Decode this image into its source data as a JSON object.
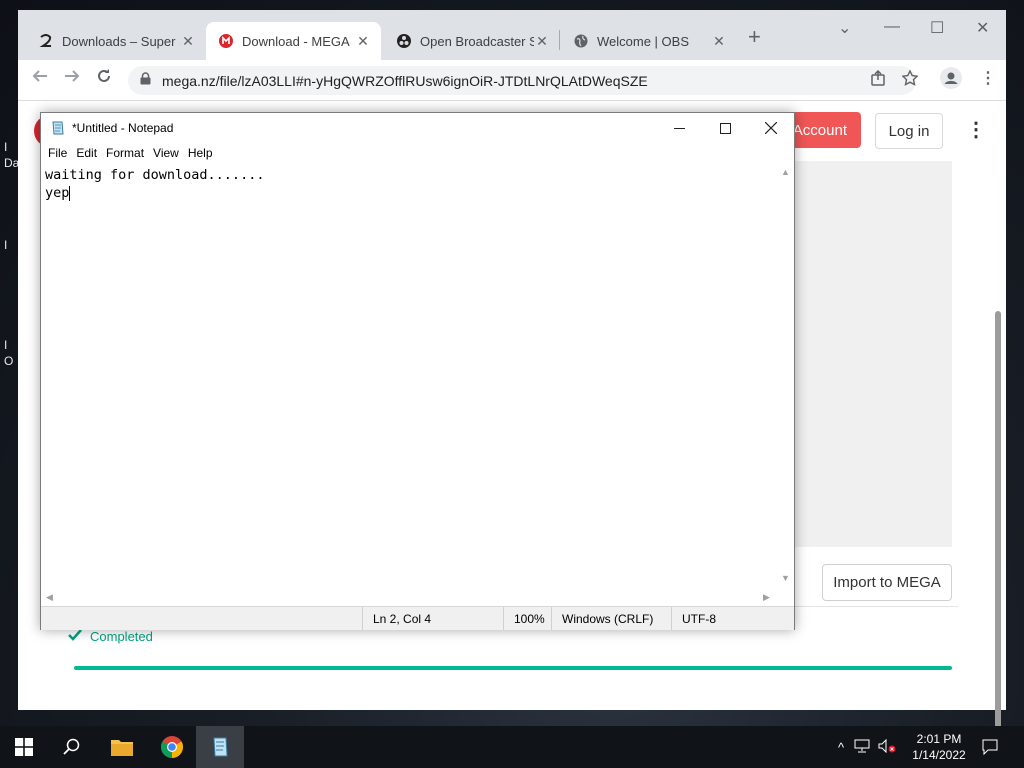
{
  "desktop": {
    "edge_labels": [
      "I",
      "Da",
      "I",
      "I",
      "O"
    ]
  },
  "browser": {
    "tabs": [
      {
        "title": "Downloads – Super S",
        "icon": "superstar-icon",
        "active": false
      },
      {
        "title": "Download - MEGA",
        "icon": "mega-icon",
        "active": true
      },
      {
        "title": "Open Broadcaster So",
        "icon": "obs-icon",
        "active": false
      },
      {
        "title": "Welcome | OBS",
        "icon": "globe-icon",
        "active": false
      }
    ],
    "close_glyph": "✕",
    "new_tab_glyph": "+",
    "window_controls": {
      "dropdown": "⌄",
      "minimize": "—",
      "maximize": "☐",
      "close": "✕"
    },
    "url": "mega.nz/file/lzA03LLI#n-yHgQWRZOfflRUsw6ignOiR-JTDtLNrQLAtDWeqSZE"
  },
  "mega": {
    "account_label": "Account",
    "login_label": "Log in",
    "menu_glyph": "⋮",
    "import_label": "Import to MEGA",
    "status_label": "Completed",
    "progress_fraction": 1.0,
    "accent_color": "#d9272e",
    "progress_color": "#00b894"
  },
  "notepad": {
    "title": "*Untitled - Notepad",
    "menu": [
      "File",
      "Edit",
      "Format",
      "View",
      "Help"
    ],
    "lines": [
      "waiting for download.......",
      "yep"
    ],
    "status": {
      "position": "Ln 2, Col 4",
      "zoom": "100%",
      "line_ending": "Windows (CRLF)",
      "encoding": "UTF-8"
    }
  },
  "taskbar": {
    "apps": [
      "start",
      "search",
      "file-explorer",
      "chrome",
      "notepad"
    ],
    "clock_time": "2:01 PM",
    "clock_date": "1/14/2022",
    "tray_chevron": "^"
  }
}
